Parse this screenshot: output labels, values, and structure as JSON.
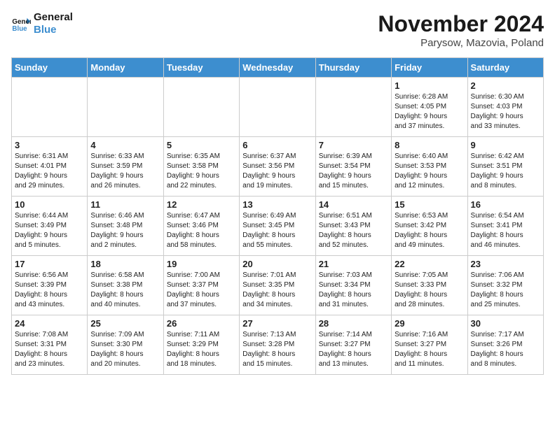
{
  "logo": {
    "line1": "General",
    "line2": "Blue"
  },
  "title": "November 2024",
  "location": "Parysow, Mazovia, Poland",
  "weekdays": [
    "Sunday",
    "Monday",
    "Tuesday",
    "Wednesday",
    "Thursday",
    "Friday",
    "Saturday"
  ],
  "weeks": [
    [
      {
        "day": "",
        "info": ""
      },
      {
        "day": "",
        "info": ""
      },
      {
        "day": "",
        "info": ""
      },
      {
        "day": "",
        "info": ""
      },
      {
        "day": "",
        "info": ""
      },
      {
        "day": "1",
        "info": "Sunrise: 6:28 AM\nSunset: 4:05 PM\nDaylight: 9 hours\nand 37 minutes."
      },
      {
        "day": "2",
        "info": "Sunrise: 6:30 AM\nSunset: 4:03 PM\nDaylight: 9 hours\nand 33 minutes."
      }
    ],
    [
      {
        "day": "3",
        "info": "Sunrise: 6:31 AM\nSunset: 4:01 PM\nDaylight: 9 hours\nand 29 minutes."
      },
      {
        "day": "4",
        "info": "Sunrise: 6:33 AM\nSunset: 3:59 PM\nDaylight: 9 hours\nand 26 minutes."
      },
      {
        "day": "5",
        "info": "Sunrise: 6:35 AM\nSunset: 3:58 PM\nDaylight: 9 hours\nand 22 minutes."
      },
      {
        "day": "6",
        "info": "Sunrise: 6:37 AM\nSunset: 3:56 PM\nDaylight: 9 hours\nand 19 minutes."
      },
      {
        "day": "7",
        "info": "Sunrise: 6:39 AM\nSunset: 3:54 PM\nDaylight: 9 hours\nand 15 minutes."
      },
      {
        "day": "8",
        "info": "Sunrise: 6:40 AM\nSunset: 3:53 PM\nDaylight: 9 hours\nand 12 minutes."
      },
      {
        "day": "9",
        "info": "Sunrise: 6:42 AM\nSunset: 3:51 PM\nDaylight: 9 hours\nand 8 minutes."
      }
    ],
    [
      {
        "day": "10",
        "info": "Sunrise: 6:44 AM\nSunset: 3:49 PM\nDaylight: 9 hours\nand 5 minutes."
      },
      {
        "day": "11",
        "info": "Sunrise: 6:46 AM\nSunset: 3:48 PM\nDaylight: 9 hours\nand 2 minutes."
      },
      {
        "day": "12",
        "info": "Sunrise: 6:47 AM\nSunset: 3:46 PM\nDaylight: 8 hours\nand 58 minutes."
      },
      {
        "day": "13",
        "info": "Sunrise: 6:49 AM\nSunset: 3:45 PM\nDaylight: 8 hours\nand 55 minutes."
      },
      {
        "day": "14",
        "info": "Sunrise: 6:51 AM\nSunset: 3:43 PM\nDaylight: 8 hours\nand 52 minutes."
      },
      {
        "day": "15",
        "info": "Sunrise: 6:53 AM\nSunset: 3:42 PM\nDaylight: 8 hours\nand 49 minutes."
      },
      {
        "day": "16",
        "info": "Sunrise: 6:54 AM\nSunset: 3:41 PM\nDaylight: 8 hours\nand 46 minutes."
      }
    ],
    [
      {
        "day": "17",
        "info": "Sunrise: 6:56 AM\nSunset: 3:39 PM\nDaylight: 8 hours\nand 43 minutes."
      },
      {
        "day": "18",
        "info": "Sunrise: 6:58 AM\nSunset: 3:38 PM\nDaylight: 8 hours\nand 40 minutes."
      },
      {
        "day": "19",
        "info": "Sunrise: 7:00 AM\nSunset: 3:37 PM\nDaylight: 8 hours\nand 37 minutes."
      },
      {
        "day": "20",
        "info": "Sunrise: 7:01 AM\nSunset: 3:35 PM\nDaylight: 8 hours\nand 34 minutes."
      },
      {
        "day": "21",
        "info": "Sunrise: 7:03 AM\nSunset: 3:34 PM\nDaylight: 8 hours\nand 31 minutes."
      },
      {
        "day": "22",
        "info": "Sunrise: 7:05 AM\nSunset: 3:33 PM\nDaylight: 8 hours\nand 28 minutes."
      },
      {
        "day": "23",
        "info": "Sunrise: 7:06 AM\nSunset: 3:32 PM\nDaylight: 8 hours\nand 25 minutes."
      }
    ],
    [
      {
        "day": "24",
        "info": "Sunrise: 7:08 AM\nSunset: 3:31 PM\nDaylight: 8 hours\nand 23 minutes."
      },
      {
        "day": "25",
        "info": "Sunrise: 7:09 AM\nSunset: 3:30 PM\nDaylight: 8 hours\nand 20 minutes."
      },
      {
        "day": "26",
        "info": "Sunrise: 7:11 AM\nSunset: 3:29 PM\nDaylight: 8 hours\nand 18 minutes."
      },
      {
        "day": "27",
        "info": "Sunrise: 7:13 AM\nSunset: 3:28 PM\nDaylight: 8 hours\nand 15 minutes."
      },
      {
        "day": "28",
        "info": "Sunrise: 7:14 AM\nSunset: 3:27 PM\nDaylight: 8 hours\nand 13 minutes."
      },
      {
        "day": "29",
        "info": "Sunrise: 7:16 AM\nSunset: 3:27 PM\nDaylight: 8 hours\nand 11 minutes."
      },
      {
        "day": "30",
        "info": "Sunrise: 7:17 AM\nSunset: 3:26 PM\nDaylight: 8 hours\nand 8 minutes."
      }
    ]
  ]
}
